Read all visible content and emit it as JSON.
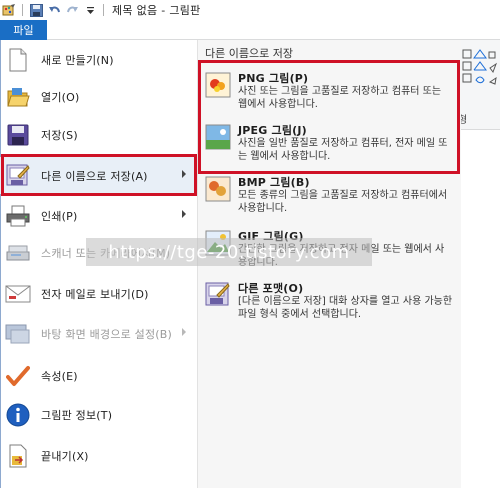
{
  "window": {
    "title": "제목 없음 - 그림판",
    "file_tab": "파일"
  },
  "ribbon": {
    "group_label": "형"
  },
  "menu": {
    "items": [
      {
        "label": "새로 만들기(N)",
        "icon": "new-file-icon"
      },
      {
        "label": "열기(O)",
        "icon": "open-folder-icon"
      },
      {
        "label": "저장(S)",
        "icon": "save-icon"
      },
      {
        "label": "다른 이름으로 저장(A)",
        "icon": "save-as-icon"
      },
      {
        "label": "인쇄(P)",
        "icon": "printer-icon"
      },
      {
        "label": "스캐너 또는 카메라에서(M)",
        "icon": "scanner-icon"
      },
      {
        "label": "전자 메일로 보내기(D)",
        "icon": "email-icon"
      },
      {
        "label": "바탕 화면 배경으로 설정(B)",
        "icon": "desktop-background-icon"
      },
      {
        "label": "속성(E)",
        "icon": "checkmark-icon"
      },
      {
        "label": "그림판 정보(T)",
        "icon": "info-icon"
      },
      {
        "label": "끝내기(X)",
        "icon": "exit-icon"
      }
    ]
  },
  "save_as": {
    "title": "다른 이름으로 저장",
    "options": [
      {
        "title": "PNG 그림(P)",
        "desc": "사진 또는 그림을 고품질로 저장하고 컴퓨터 또는 웹에서 사용합니다.",
        "icon": "png-image-icon"
      },
      {
        "title": "JPEG 그림(J)",
        "desc": "사진을 일반 품질로 저장하고 컴퓨터, 전자 메일 또는 웹에서 사용합니다.",
        "icon": "jpeg-image-icon"
      },
      {
        "title": "BMP 그림(B)",
        "desc": "모든 종류의 그림을 고품질로 저장하고 컴퓨터에서 사용합니다.",
        "icon": "bmp-image-icon"
      },
      {
        "title": "GIF 그림(G)",
        "desc": "간단한 그림을 저장하고 전자 메일 또는 웹에서 사용합니다.",
        "icon": "gif-image-icon"
      },
      {
        "title": "다른 포맷(O)",
        "desc": "[다른 이름으로 저장] 대화 상자를 열고 사용 가능한 파일 형식 중에서 선택합니다.",
        "icon": "other-format-icon"
      }
    ]
  },
  "watermark": "https://tge-20.tistory.com",
  "colors": {
    "accent": "#1a6ec5",
    "highlight_border": "#cf1126",
    "selected_bg": "#e8eff7"
  }
}
